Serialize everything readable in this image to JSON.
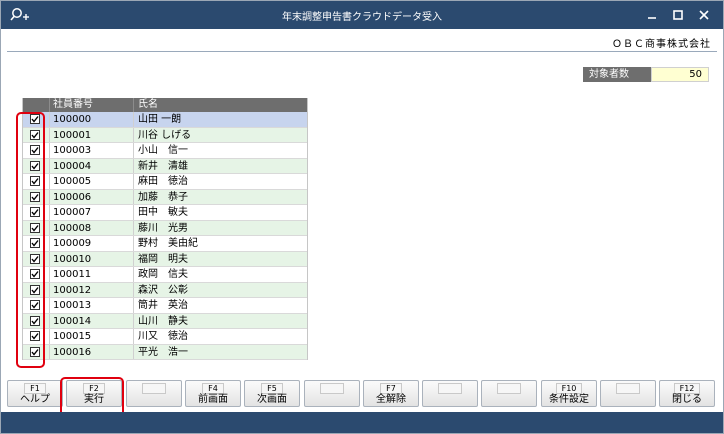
{
  "window": {
    "title": "年末調整申告書クラウドデータ受入",
    "icons": {
      "search": "search-plus-icon",
      "minimize": "minimize-icon",
      "maximize": "maximize-icon",
      "close": "close-icon"
    }
  },
  "company_name": "ＯＢＣ商事株式会社",
  "summary": {
    "label": "対象者数",
    "value": "50"
  },
  "table": {
    "headers": {
      "check": "",
      "employee_no": "社員番号",
      "name": "氏名"
    },
    "rows": [
      {
        "checked": true,
        "employee_no": "100000",
        "name": "山田 一朗",
        "selected": true
      },
      {
        "checked": true,
        "employee_no": "100001",
        "name": "川谷 しげる"
      },
      {
        "checked": true,
        "employee_no": "100003",
        "name": "小山　信一"
      },
      {
        "checked": true,
        "employee_no": "100004",
        "name": "新井　清雄"
      },
      {
        "checked": true,
        "employee_no": "100005",
        "name": "麻田　徳治"
      },
      {
        "checked": true,
        "employee_no": "100006",
        "name": "加藤　恭子"
      },
      {
        "checked": true,
        "employee_no": "100007",
        "name": "田中　敏夫"
      },
      {
        "checked": true,
        "employee_no": "100008",
        "name": "藤川　光男"
      },
      {
        "checked": true,
        "employee_no": "100009",
        "name": "野村　美由紀"
      },
      {
        "checked": true,
        "employee_no": "100010",
        "name": "福岡　明夫"
      },
      {
        "checked": true,
        "employee_no": "100011",
        "name": "政岡　信夫"
      },
      {
        "checked": true,
        "employee_no": "100012",
        "name": "森沢　公彰"
      },
      {
        "checked": true,
        "employee_no": "100013",
        "name": "筒井　英治"
      },
      {
        "checked": true,
        "employee_no": "100014",
        "name": "山川　静夫"
      },
      {
        "checked": true,
        "employee_no": "100015",
        "name": "川又　徳治"
      },
      {
        "checked": true,
        "employee_no": "100016",
        "name": "平光　浩一"
      }
    ]
  },
  "function_keys": [
    {
      "key": "F1",
      "label": "ヘルプ"
    },
    {
      "key": "F2",
      "label": "実行"
    },
    {
      "key": "",
      "label": ""
    },
    {
      "key": "F4",
      "label": "前画面"
    },
    {
      "key": "F5",
      "label": "次画面"
    },
    {
      "key": "",
      "label": ""
    },
    {
      "key": "F7",
      "label": "全解除"
    },
    {
      "key": "",
      "label": ""
    },
    {
      "key": "",
      "label": ""
    },
    {
      "key": "F10",
      "label": "条件設定"
    },
    {
      "key": "",
      "label": ""
    },
    {
      "key": "F12",
      "label": "閉じる"
    }
  ],
  "colors": {
    "titlebar": "#2b4a6f",
    "highlight": "#e0000f",
    "row_alt": "#e6f4e6",
    "row_selected": "#c7d4ee",
    "count_bg": "#ffffd2"
  }
}
